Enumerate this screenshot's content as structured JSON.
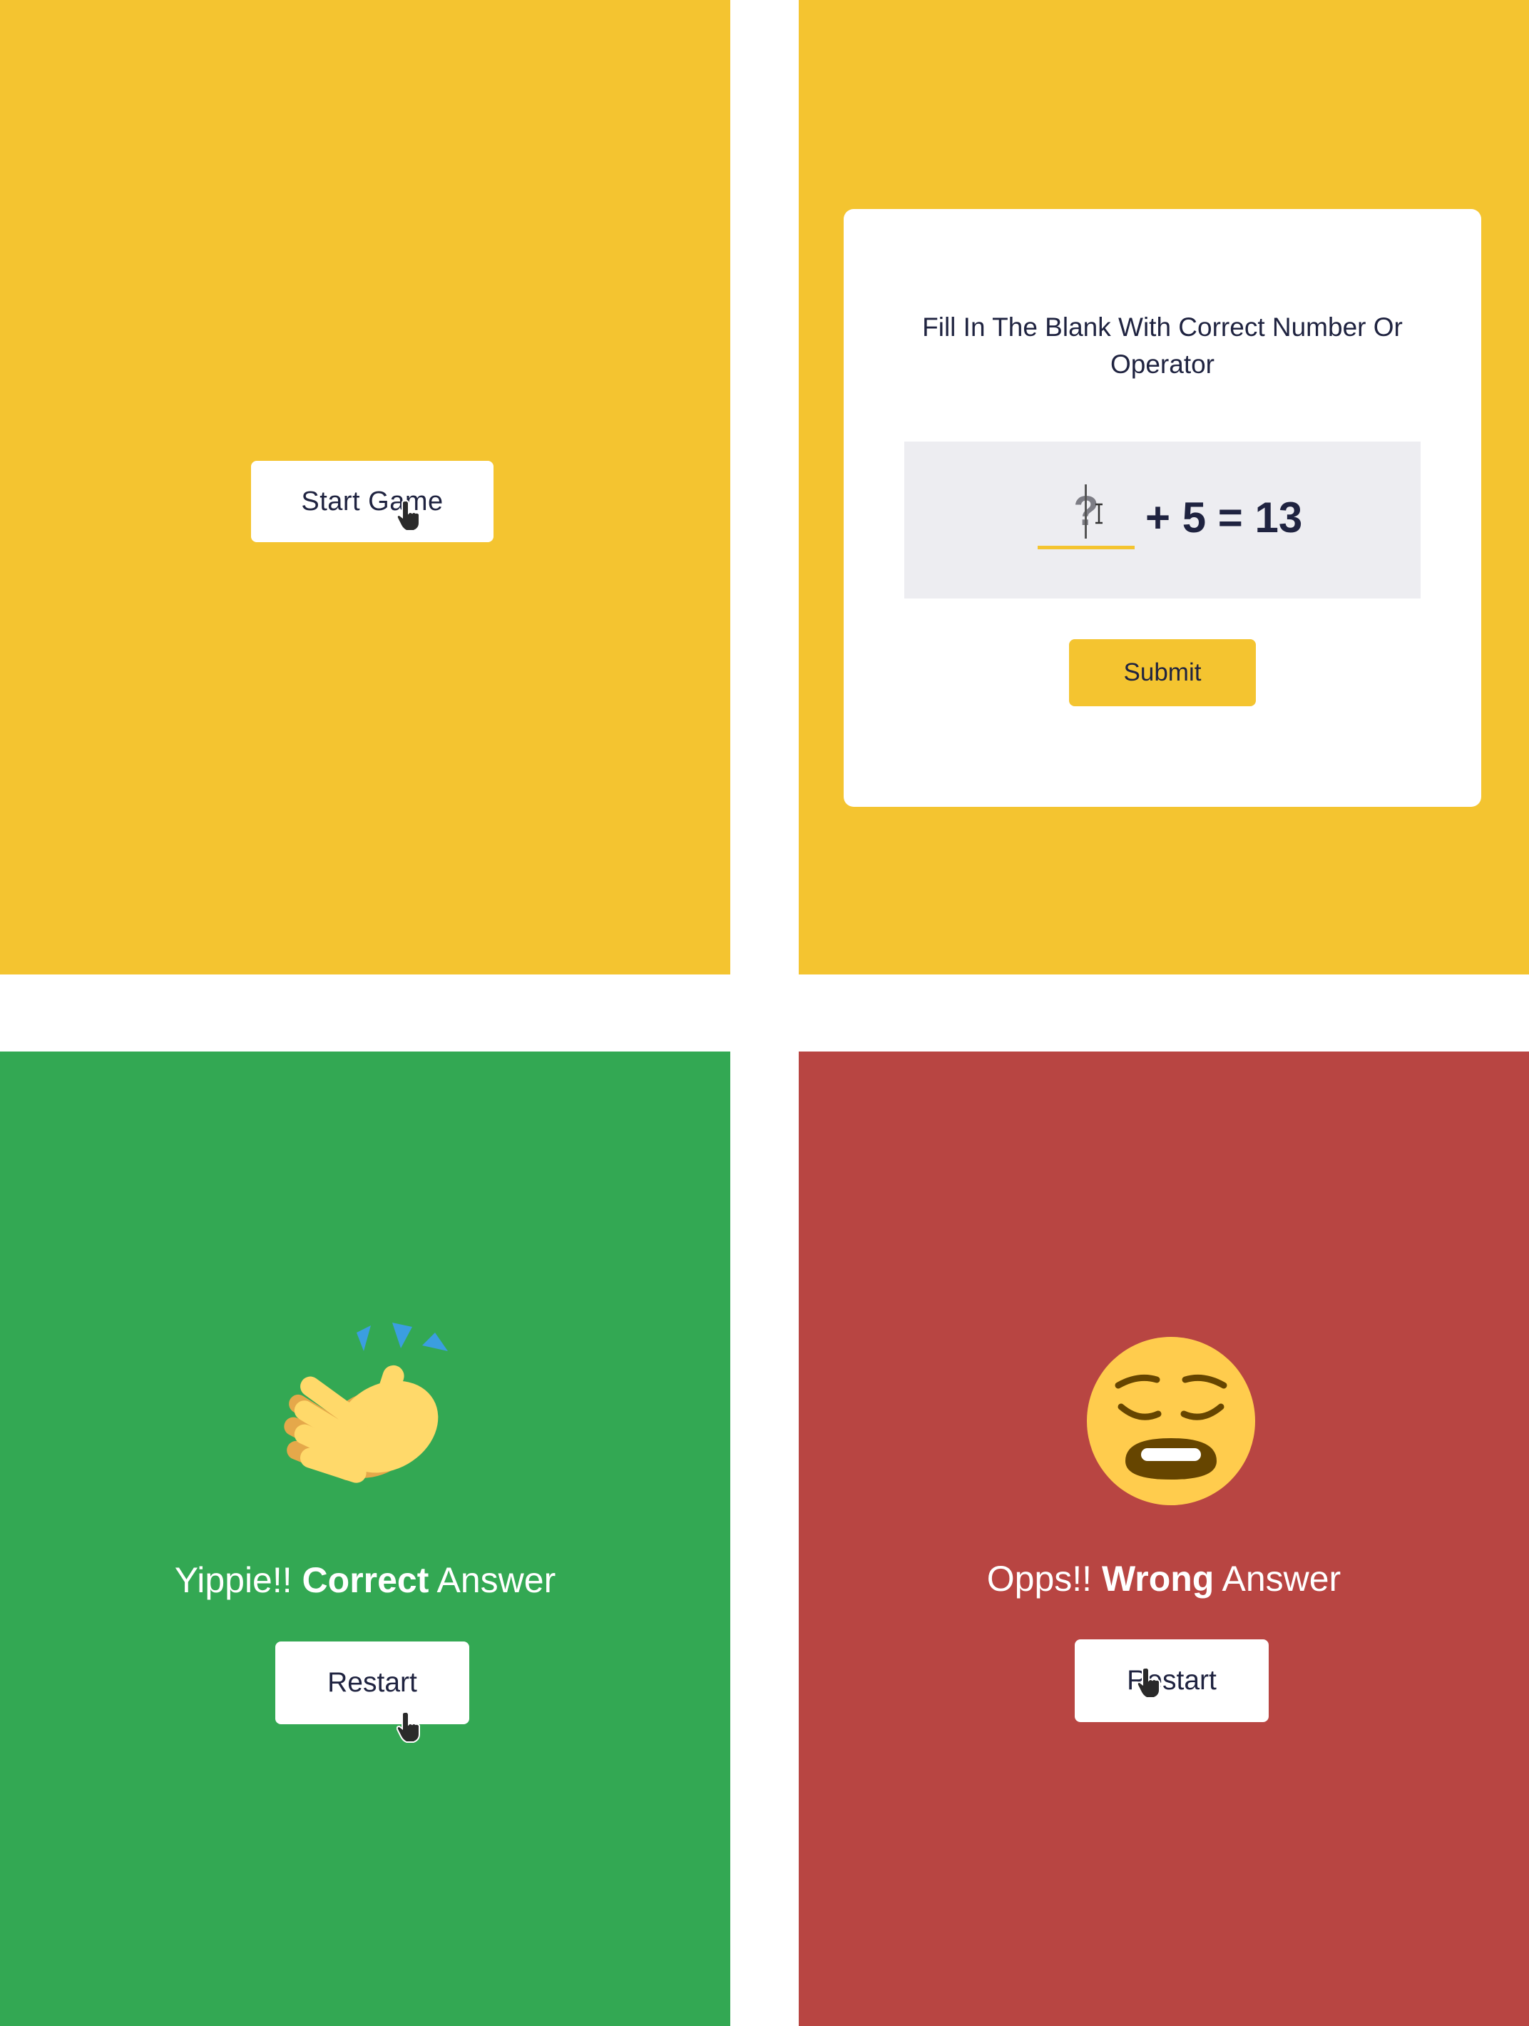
{
  "start_screen": {
    "start_button_label": "Start Game"
  },
  "game_screen": {
    "instruction": "Fill In The Blank With Correct Number Or Operator",
    "blank_placeholder": "?",
    "equation_rest": "+ 5 = 13",
    "submit_label": "Submit"
  },
  "correct_screen": {
    "icon": "clapping-hands-icon",
    "message_prefix": "Yippie!! ",
    "message_bold": "Correct",
    "message_suffix": " Answer",
    "restart_label": "Restart"
  },
  "wrong_screen": {
    "icon": "weary-face-icon",
    "message_prefix": "Opps!! ",
    "message_bold": "Wrong",
    "message_suffix": " Answer",
    "restart_label": "Restart"
  },
  "colors": {
    "yellow": "#f4c430",
    "green": "#33a853",
    "red": "#b84542",
    "text_dark": "#1f2340",
    "input_bg": "#ededf1"
  }
}
